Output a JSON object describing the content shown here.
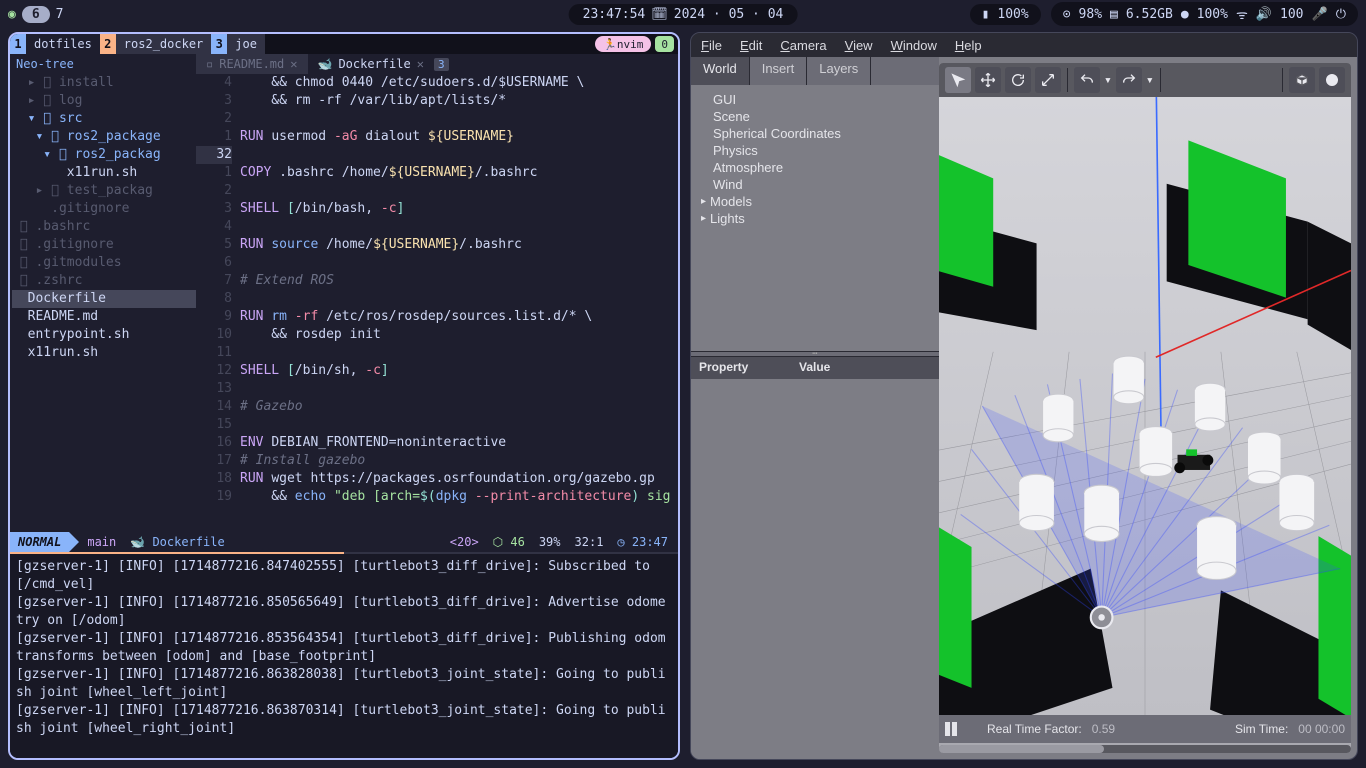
{
  "topbar": {
    "ws_active": "6",
    "ws_next": "7",
    "time": "23:47:54",
    "date": "2024 · 05 · 04",
    "bat_left": "100%",
    "cpu": "98%",
    "mem": "6.52GB",
    "disk": "100%",
    "net": "100"
  },
  "nvim_tabs": [
    {
      "num": "1",
      "label": "dotfiles"
    },
    {
      "num": "2",
      "label": "ros2_docker"
    },
    {
      "num": "3",
      "label": "joe"
    }
  ],
  "nvim_right": {
    "user": "nvim",
    "count": "0"
  },
  "neotree_label": "Neo-tree",
  "buffers": [
    {
      "label": "README.md",
      "badge": ""
    },
    {
      "label": "Dockerfile",
      "badge": "3"
    }
  ],
  "filetree": [
    {
      "txt": "  ▸ 󰉋 install",
      "cls": "dim"
    },
    {
      "txt": "  ▸ 󰉋 log",
      "cls": "dim"
    },
    {
      "txt": "  ▾ 󰉋 src",
      "cls": "folder"
    },
    {
      "txt": "   ▾ 󰉋 ros2_package",
      "cls": "folder"
    },
    {
      "txt": "    ▾ 󰉋 ros2_packag",
      "cls": "folder"
    },
    {
      "txt": "       x11run.sh",
      "cls": "file"
    },
    {
      "txt": "   ▸ 󰉋 test_packag",
      "cls": "dim"
    },
    {
      "txt": "     .gitignore",
      "cls": "dim"
    },
    {
      "txt": " 󰜘 .bashrc",
      "cls": "dim"
    },
    {
      "txt": " 󰜘 .gitignore",
      "cls": "dim"
    },
    {
      "txt": " 󰜘 .gitmodules",
      "cls": "dim"
    },
    {
      "txt": " 󰜘 .zshrc",
      "cls": "dim"
    },
    {
      "txt": "  Dockerfile",
      "cls": "sel"
    },
    {
      "txt": "  README.md",
      "cls": "file"
    },
    {
      "txt": "  entrypoint.sh",
      "cls": "file"
    },
    {
      "txt": "  x11run.sh",
      "cls": "file"
    }
  ],
  "gutter": [
    "4",
    "3",
    "2",
    "1",
    "32",
    "1",
    "2",
    "3",
    "4",
    "5",
    "6",
    "7",
    "8",
    "9",
    "10",
    "11",
    "12",
    "13",
    "14",
    "15",
    "16",
    "17",
    "18",
    "19"
  ],
  "gutter_current_index": 4,
  "code": [
    [
      {
        "t": "    && chmod 0440 /etc/sudoers.d/$USERNAME \\",
        "c": "pl"
      }
    ],
    [
      {
        "t": "    && rm -rf /var/lib/apt/lists/*",
        "c": "pl"
      }
    ],
    [
      {
        "t": "",
        "c": "pl"
      }
    ],
    [
      {
        "t": "RUN ",
        "c": "kw"
      },
      {
        "t": "usermod ",
        "c": "pl"
      },
      {
        "t": "-aG",
        "c": "flag"
      },
      {
        "t": " dialout ",
        "c": "pl"
      },
      {
        "t": "${USERNAME}",
        "c": "var"
      }
    ],
    [
      {
        "t": " ",
        "c": "pl"
      }
    ],
    [
      {
        "t": "COPY ",
        "c": "kw"
      },
      {
        "t": ".bashrc /home/",
        "c": "pl"
      },
      {
        "t": "${USERNAME}",
        "c": "var"
      },
      {
        "t": "/.bashrc",
        "c": "pl"
      }
    ],
    [
      {
        "t": "",
        "c": "pl"
      }
    ],
    [
      {
        "t": "SHELL ",
        "c": "kw"
      },
      {
        "t": "[",
        "c": "op"
      },
      {
        "t": "/bin/bash",
        "c": "pl"
      },
      {
        "t": ", ",
        "c": "pl"
      },
      {
        "t": "-c",
        "c": "flag"
      },
      {
        "t": "]",
        "c": "op"
      }
    ],
    [
      {
        "t": "",
        "c": "pl"
      }
    ],
    [
      {
        "t": "RUN ",
        "c": "kw"
      },
      {
        "t": "source",
        "c": "fn"
      },
      {
        "t": " /home/",
        "c": "pl"
      },
      {
        "t": "${USERNAME}",
        "c": "var"
      },
      {
        "t": "/.bashrc",
        "c": "pl"
      }
    ],
    [
      {
        "t": "",
        "c": "pl"
      }
    ],
    [
      {
        "t": "# Extend ROS",
        "c": "cmt"
      }
    ],
    [
      {
        "t": "",
        "c": "pl"
      }
    ],
    [
      {
        "t": "RUN ",
        "c": "kw"
      },
      {
        "t": "rm ",
        "c": "fn"
      },
      {
        "t": "-rf",
        "c": "flag"
      },
      {
        "t": " /etc/ros/rosdep/sources.list.d/* \\",
        "c": "pl"
      }
    ],
    [
      {
        "t": "    && rosdep init",
        "c": "pl"
      }
    ],
    [
      {
        "t": "",
        "c": "pl"
      }
    ],
    [
      {
        "t": "SHELL ",
        "c": "kw"
      },
      {
        "t": "[",
        "c": "op"
      },
      {
        "t": "/bin/sh",
        "c": "pl"
      },
      {
        "t": ", ",
        "c": "pl"
      },
      {
        "t": "-c",
        "c": "flag"
      },
      {
        "t": "]",
        "c": "op"
      }
    ],
    [
      {
        "t": "",
        "c": "pl"
      }
    ],
    [
      {
        "t": "# Gazebo",
        "c": "cmt"
      }
    ],
    [
      {
        "t": "",
        "c": "pl"
      }
    ],
    [
      {
        "t": "ENV ",
        "c": "kw"
      },
      {
        "t": "DEBIAN_FRONTEND=noninteractive",
        "c": "pl"
      }
    ],
    [
      {
        "t": "# Install gazebo",
        "c": "cmt"
      }
    ],
    [
      {
        "t": "RUN ",
        "c": "kw"
      },
      {
        "t": "wget https://packages.osrfoundation.org/gazebo.gp",
        "c": "pl"
      }
    ],
    [
      {
        "t": "    && ",
        "c": "pl"
      },
      {
        "t": "echo ",
        "c": "fn"
      },
      {
        "t": "\"deb [arch=",
        "c": "str"
      },
      {
        "t": "$(",
        "c": "op"
      },
      {
        "t": "dpkg ",
        "c": "fn"
      },
      {
        "t": "--print-architecture",
        "c": "flag"
      },
      {
        "t": ")",
        "c": "op"
      },
      {
        "t": " sig",
        "c": "str"
      }
    ]
  ],
  "statusline": {
    "mode": "NORMAL",
    "branch": "main",
    "file": "Dockerfile",
    "enc": "<20>",
    "diag": "46",
    "pct": "39%",
    "pos": "32:1",
    "clock": "23:47"
  },
  "terminal": [
    "[gzserver-1] [INFO] [1714877216.847402555] [turtlebot3_diff_drive]: Subscribed to [/cmd_vel]",
    "[gzserver-1] [INFO] [1714877216.850565649] [turtlebot3_diff_drive]: Advertise odometry on [/odom]",
    "[gzserver-1] [INFO] [1714877216.853564354] [turtlebot3_diff_drive]: Publishing odom transforms between [odom] and [base_footprint]",
    "[gzserver-1] [INFO] [1714877216.863828038] [turtlebot3_joint_state]: Going to publish joint [wheel_left_joint]",
    "[gzserver-1] [INFO] [1714877216.863870314] [turtlebot3_joint_state]: Going to publish joint [wheel_right_joint]"
  ],
  "gazebo": {
    "menu": [
      "File",
      "Edit",
      "Camera",
      "View",
      "Window",
      "Help"
    ],
    "tabs": [
      "World",
      "Insert",
      "Layers"
    ],
    "tree": [
      "GUI",
      "Scene",
      "Spherical Coordinates",
      "Physics",
      "Atmosphere",
      "Wind",
      "Models",
      "Lights"
    ],
    "prop_headers": [
      "Property",
      "Value"
    ],
    "rtf_label": "Real Time Factor:",
    "rtf": "0.59",
    "simtime_label": "Sim Time:",
    "simtime": "00 00:00"
  }
}
